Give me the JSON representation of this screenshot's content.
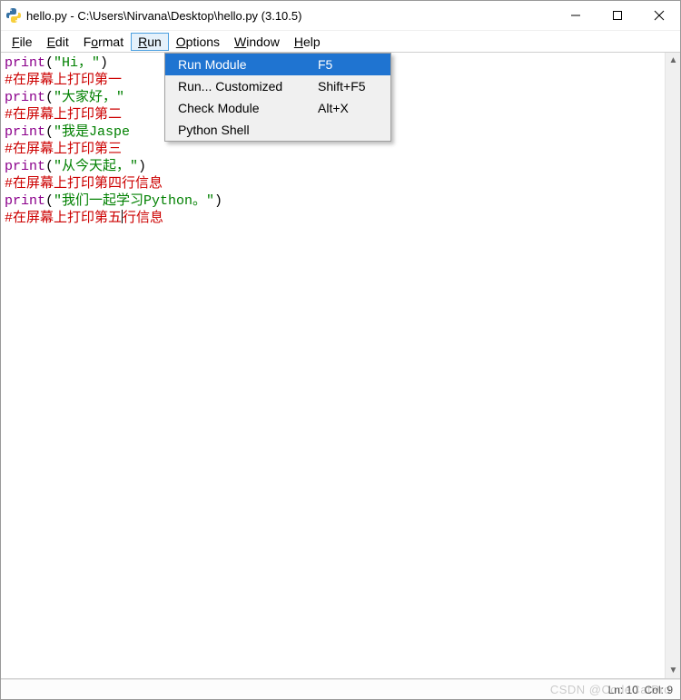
{
  "window": {
    "title": "hello.py - C:\\Users\\Nirvana\\Desktop\\hello.py (3.10.5)"
  },
  "menubar": {
    "items": [
      {
        "label": "File",
        "mnemonic_index": 0
      },
      {
        "label": "Edit",
        "mnemonic_index": 0
      },
      {
        "label": "Format",
        "mnemonic_index": 1
      },
      {
        "label": "Run",
        "mnemonic_index": 0,
        "open": true
      },
      {
        "label": "Options",
        "mnemonic_index": 0
      },
      {
        "label": "Window",
        "mnemonic_index": 0
      },
      {
        "label": "Help",
        "mnemonic_index": 0
      }
    ]
  },
  "run_menu": {
    "items": [
      {
        "label": "Run Module",
        "shortcut": "F5",
        "selected": true
      },
      {
        "label": "Run... Customized",
        "shortcut": "Shift+F5",
        "selected": false
      },
      {
        "label": "Check Module",
        "shortcut": "Alt+X",
        "selected": false
      },
      {
        "label": "Python Shell",
        "shortcut": "",
        "selected": false
      }
    ]
  },
  "code": {
    "lines": [
      {
        "tokens": [
          {
            "t": "fn",
            "v": "print"
          },
          {
            "t": "plain",
            "v": "("
          },
          {
            "t": "str",
            "v": "\"Hi，\""
          },
          {
            "t": "plain",
            "v": ")"
          }
        ]
      },
      {
        "tokens": [
          {
            "t": "cmt",
            "v": "#在屏幕上打印第一"
          }
        ]
      },
      {
        "tokens": [
          {
            "t": "fn",
            "v": "print"
          },
          {
            "t": "plain",
            "v": "("
          },
          {
            "t": "str",
            "v": "\"大家好，\""
          }
        ]
      },
      {
        "tokens": [
          {
            "t": "cmt",
            "v": "#在屏幕上打印第二"
          }
        ]
      },
      {
        "tokens": [
          {
            "t": "fn",
            "v": "print"
          },
          {
            "t": "plain",
            "v": "("
          },
          {
            "t": "str",
            "v": "\"我是Jaspe"
          }
        ]
      },
      {
        "tokens": [
          {
            "t": "cmt",
            "v": "#在屏幕上打印第三"
          }
        ]
      },
      {
        "tokens": [
          {
            "t": "fn",
            "v": "print"
          },
          {
            "t": "plain",
            "v": "("
          },
          {
            "t": "str",
            "v": "\"从今天起，\""
          },
          {
            "t": "plain",
            "v": ")"
          }
        ]
      },
      {
        "tokens": [
          {
            "t": "cmt",
            "v": "#在屏幕上打印第四行信息"
          }
        ]
      },
      {
        "tokens": [
          {
            "t": "fn",
            "v": "print"
          },
          {
            "t": "plain",
            "v": "("
          },
          {
            "t": "str",
            "v": "\"我们一起学习Python。\""
          },
          {
            "t": "plain",
            "v": ")"
          }
        ]
      },
      {
        "tokens": [
          {
            "t": "cmt",
            "v": "#在屏幕上打印第五"
          },
          {
            "t": "caret",
            "v": ""
          },
          {
            "t": "cmt",
            "v": "行信息"
          }
        ]
      }
    ]
  },
  "status": {
    "line_label": "Ln:",
    "line_value": "10",
    "col_label": "Col:",
    "col_value": "9",
    "watermark": "CSDN @CodeCatPro"
  }
}
